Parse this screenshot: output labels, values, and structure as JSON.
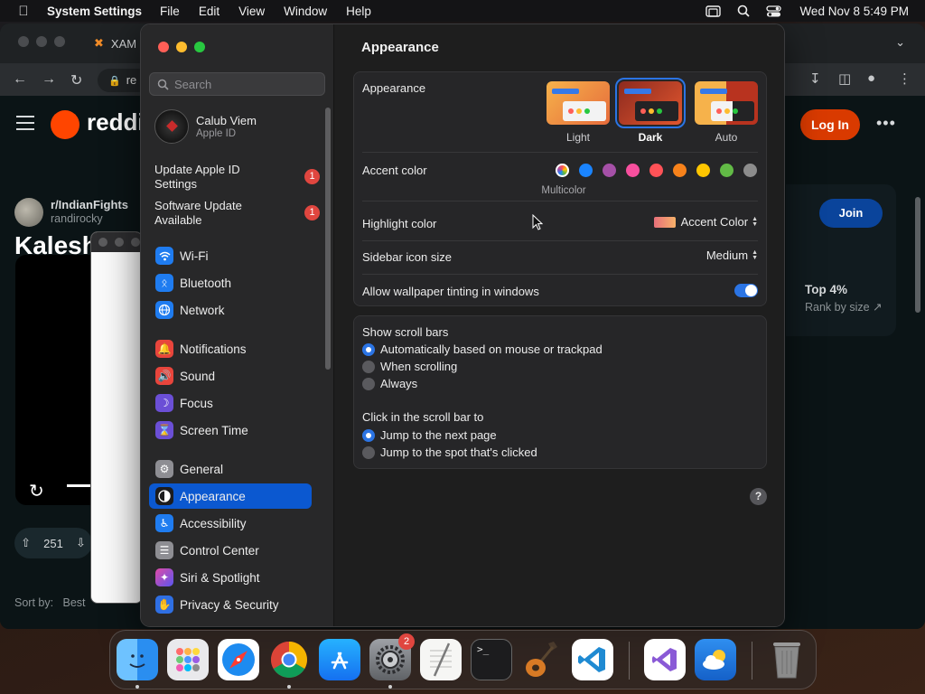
{
  "menubar": {
    "app": "System Settings",
    "items": [
      "File",
      "Edit",
      "View",
      "Window",
      "Help"
    ],
    "clock": "Wed Nov 8  5:49 PM"
  },
  "browser": {
    "tab_title": "XAM",
    "url_fragment": "re",
    "reddit": {
      "logo_text": "reddit",
      "subreddit": "r/IndianFights",
      "username": "randirocky",
      "post_title": "Kalesh be",
      "votes": "251",
      "sort_label": "Sort by:",
      "sort_value": "Best",
      "login_label": "Log In",
      "join_label": "Join",
      "top_percent": "Top 4%",
      "rank_label": "Rank by size"
    }
  },
  "settings": {
    "search_placeholder": "Search",
    "account": {
      "name": "Calub Viem",
      "subtitle": "Apple ID"
    },
    "notices": [
      {
        "label": "Update Apple ID Settings",
        "count": "1"
      },
      {
        "label": "Software Update Available",
        "count": "1"
      }
    ],
    "sidebar_group1": [
      {
        "label": "Wi-Fi",
        "color": "#1f7cf0",
        "icon": "wifi-icon"
      },
      {
        "label": "Bluetooth",
        "color": "#1f7cf0",
        "icon": "bluetooth-icon"
      },
      {
        "label": "Network",
        "color": "#1f7cf0",
        "icon": "globe-icon"
      }
    ],
    "sidebar_group2": [
      {
        "label": "Notifications",
        "color": "#e8453c",
        "icon": "bell-icon"
      },
      {
        "label": "Sound",
        "color": "#e8453c",
        "icon": "speaker-icon"
      },
      {
        "label": "Focus",
        "color": "#6b4fd6",
        "icon": "moon-icon"
      },
      {
        "label": "Screen Time",
        "color": "#6b4fd6",
        "icon": "hourglass-icon"
      }
    ],
    "sidebar_group3": [
      {
        "label": "General",
        "color": "#8e8e93",
        "icon": "gear-icon"
      },
      {
        "label": "Appearance",
        "color": "#1c1c1e",
        "icon": "appearance-icon"
      },
      {
        "label": "Accessibility",
        "color": "#1f7cf0",
        "icon": "accessibility-icon"
      },
      {
        "label": "Control Center",
        "color": "#8e8e93",
        "icon": "toggles-icon"
      },
      {
        "label": "Siri & Spotlight",
        "color": "#b43fd6",
        "icon": "siri-icon"
      },
      {
        "label": "Privacy & Security",
        "color": "#2f6fe3",
        "icon": "hand-icon"
      }
    ],
    "selected": "Appearance",
    "page_title": "Appearance",
    "appearance": {
      "label": "Appearance",
      "options": [
        "Light",
        "Dark",
        "Auto"
      ],
      "selected": "Dark"
    },
    "accent": {
      "label": "Accent color",
      "selected_caption": "Multicolor",
      "colors": [
        "#1a84ff",
        "#a550a7",
        "#f74f9e",
        "#ff5257",
        "#f7821b",
        "#ffc600",
        "#62ba46",
        "#8c8c8c"
      ]
    },
    "highlight": {
      "label": "Highlight color",
      "value": "Accent Color"
    },
    "sidebar_icon": {
      "label": "Sidebar icon size",
      "value": "Medium"
    },
    "tinting": {
      "label": "Allow wallpaper tinting in windows",
      "on": true
    },
    "scroll_bars": {
      "label": "Show scroll bars",
      "options": [
        "Automatically based on mouse or trackpad",
        "When scrolling",
        "Always"
      ],
      "selected": 0
    },
    "click_scroll": {
      "label": "Click in the scroll bar to",
      "options": [
        "Jump to the next page",
        "Jump to the spot that's clicked"
      ],
      "selected": 0
    },
    "help": "?"
  },
  "dock": {
    "apps": [
      {
        "name": "Finder",
        "icon": "finder-icon",
        "running": true
      },
      {
        "name": "Launchpad",
        "icon": "launchpad-icon",
        "running": false
      },
      {
        "name": "Safari",
        "icon": "safari-icon",
        "running": false
      },
      {
        "name": "Google Chrome",
        "icon": "chrome-icon",
        "running": true
      },
      {
        "name": "App Store",
        "icon": "appstore-icon",
        "running": false
      },
      {
        "name": "System Settings",
        "icon": "settings-icon",
        "running": true,
        "badge": "2"
      },
      {
        "name": "TextEdit",
        "icon": "textedit-icon",
        "running": false
      },
      {
        "name": "Terminal",
        "icon": "terminal-icon",
        "running": false
      },
      {
        "name": "GarageBand",
        "icon": "guitar-icon",
        "running": false
      },
      {
        "name": "Visual Studio Code",
        "icon": "vscode-icon",
        "running": false
      },
      {
        "name": "Visual Studio",
        "icon": "visualstudio-icon",
        "running": false
      },
      {
        "name": "Weather",
        "icon": "weather-icon",
        "running": false
      },
      {
        "name": "Trash",
        "icon": "trash-icon",
        "running": false
      }
    ]
  }
}
